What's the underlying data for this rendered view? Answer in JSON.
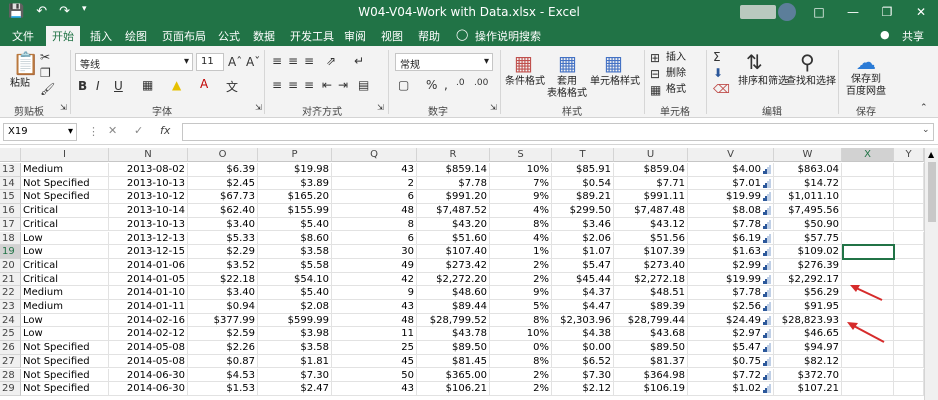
{
  "title": "W04-V04-Work with Data.xlsx  -  Excel",
  "share_label": "共享",
  "tabs": [
    "文件",
    "开始",
    "插入",
    "绘图",
    "页面布局",
    "公式",
    "数据",
    "开发工具",
    "审阅",
    "视图",
    "帮助",
    "操作说明搜索"
  ],
  "active_tab": "开始",
  "ribbon": {
    "paste_label": "粘贴",
    "clipboard_label": "剪贴板",
    "font_name": "等线",
    "font_size": "11",
    "font_label": "字体",
    "align_label": "对齐方式",
    "number_format": "常规",
    "number_label": "数字",
    "cond_format_label": "条件格式",
    "table_format_label": "套用\n表格格式",
    "cell_style_label": "单元格样式",
    "styles_label": "样式",
    "insert_label": "插入",
    "delete_label": "删除",
    "format_label": "格式",
    "cells_label": "单元格",
    "sort_filter_label": "排序和筛选",
    "find_select_label": "查找和选择",
    "edit_label": "编辑",
    "save_to_label": "保存到\n百度网盘",
    "save_label": "保存"
  },
  "name_box": "X19",
  "fx_label": "fx",
  "columns": [
    "I",
    "N",
    "O",
    "P",
    "Q",
    "R",
    "S",
    "T",
    "U",
    "V",
    "W",
    "X",
    "Y"
  ],
  "rows": [
    {
      "n": "13",
      "I": "Medium",
      "N": "2013-08-02",
      "O": "$6.39",
      "P": "$19.98",
      "Q": "43",
      "R": "$859.14",
      "S": "10%",
      "T": "$85.91",
      "U": "$859.04",
      "V": "$4.00",
      "W": "$863.04"
    },
    {
      "n": "14",
      "I": "Not Specified",
      "N": "2013-10-13",
      "O": "$2.45",
      "P": "$3.89",
      "Q": "2",
      "R": "$7.78",
      "S": "7%",
      "T": "$0.54",
      "U": "$7.71",
      "V": "$7.01",
      "W": "$14.72"
    },
    {
      "n": "15",
      "I": "Not Specified",
      "N": "2013-10-12",
      "O": "$67.73",
      "P": "$165.20",
      "Q": "6",
      "R": "$991.20",
      "S": "9%",
      "T": "$89.21",
      "U": "$991.11",
      "V": "$19.99",
      "W": "$1,011.10"
    },
    {
      "n": "16",
      "I": "Critical",
      "N": "2013-10-14",
      "O": "$62.40",
      "P": "$155.99",
      "Q": "48",
      "R": "$7,487.52",
      "S": "4%",
      "T": "$299.50",
      "U": "$7,487.48",
      "V": "$8.08",
      "W": "$7,495.56"
    },
    {
      "n": "17",
      "I": "Critical",
      "N": "2013-10-13",
      "O": "$3.40",
      "P": "$5.40",
      "Q": "8",
      "R": "$43.20",
      "S": "8%",
      "T": "$3.46",
      "U": "$43.12",
      "V": "$7.78",
      "W": "$50.90"
    },
    {
      "n": "18",
      "I": "Low",
      "N": "2013-12-13",
      "O": "$5.33",
      "P": "$8.60",
      "Q": "6",
      "R": "$51.60",
      "S": "4%",
      "T": "$2.06",
      "U": "$51.56",
      "V": "$6.19",
      "W": "$57.75"
    },
    {
      "n": "19",
      "I": "Low",
      "N": "2013-12-15",
      "O": "$2.29",
      "P": "$3.58",
      "Q": "30",
      "R": "$107.40",
      "S": "1%",
      "T": "$1.07",
      "U": "$107.39",
      "V": "$1.63",
      "W": "$109.02"
    },
    {
      "n": "20",
      "I": "Critical",
      "N": "2014-01-06",
      "O": "$3.52",
      "P": "$5.58",
      "Q": "49",
      "R": "$273.42",
      "S": "2%",
      "T": "$5.47",
      "U": "$273.40",
      "V": "$2.99",
      "W": "$276.39"
    },
    {
      "n": "21",
      "I": "Critical",
      "N": "2014-01-05",
      "O": "$22.18",
      "P": "$54.10",
      "Q": "42",
      "R": "$2,272.20",
      "S": "2%",
      "T": "$45.44",
      "U": "$2,272.18",
      "V": "$19.99",
      "W": "$2,292.17"
    },
    {
      "n": "22",
      "I": "Medium",
      "N": "2014-01-10",
      "O": "$3.40",
      "P": "$5.40",
      "Q": "9",
      "R": "$48.60",
      "S": "9%",
      "T": "$4.37",
      "U": "$48.51",
      "V": "$7.78",
      "W": "$56.29"
    },
    {
      "n": "23",
      "I": "Medium",
      "N": "2014-01-11",
      "O": "$0.94",
      "P": "$2.08",
      "Q": "43",
      "R": "$89.44",
      "S": "5%",
      "T": "$4.47",
      "U": "$89.39",
      "V": "$2.56",
      "W": "$91.95"
    },
    {
      "n": "24",
      "I": "Low",
      "N": "2014-02-16",
      "O": "$377.99",
      "P": "$599.99",
      "Q": "48",
      "R": "$28,799.52",
      "S": "8%",
      "T": "$2,303.96",
      "U": "$28,799.44",
      "V": "$24.49",
      "W": "$28,823.93"
    },
    {
      "n": "25",
      "I": "Low",
      "N": "2014-02-12",
      "O": "$2.59",
      "P": "$3.98",
      "Q": "11",
      "R": "$43.78",
      "S": "10%",
      "T": "$4.38",
      "U": "$43.68",
      "V": "$2.97",
      "W": "$46.65"
    },
    {
      "n": "26",
      "I": "Not Specified",
      "N": "2014-05-08",
      "O": "$2.26",
      "P": "$3.58",
      "Q": "25",
      "R": "$89.50",
      "S": "0%",
      "T": "$0.00",
      "U": "$89.50",
      "V": "$5.47",
      "W": "$94.97"
    },
    {
      "n": "27",
      "I": "Not Specified",
      "N": "2014-05-08",
      "O": "$0.87",
      "P": "$1.81",
      "Q": "45",
      "R": "$81.45",
      "S": "8%",
      "T": "$6.52",
      "U": "$81.37",
      "V": "$0.75",
      "W": "$82.12"
    },
    {
      "n": "28",
      "I": "Not Specified",
      "N": "2014-06-30",
      "O": "$4.53",
      "P": "$7.30",
      "Q": "50",
      "R": "$365.00",
      "S": "2%",
      "T": "$7.30",
      "U": "$364.98",
      "V": "$7.72",
      "W": "$372.70"
    },
    {
      "n": "29",
      "I": "Not Specified",
      "N": "2014-06-30",
      "O": "$1.53",
      "P": "$2.47",
      "Q": "43",
      "R": "$106.21",
      "S": "2%",
      "T": "$2.12",
      "U": "$106.19",
      "V": "$1.02",
      "W": "$107.21"
    }
  ],
  "colors": {
    "excel_green": "#217346",
    "annotation_red": "#d62b2b"
  }
}
